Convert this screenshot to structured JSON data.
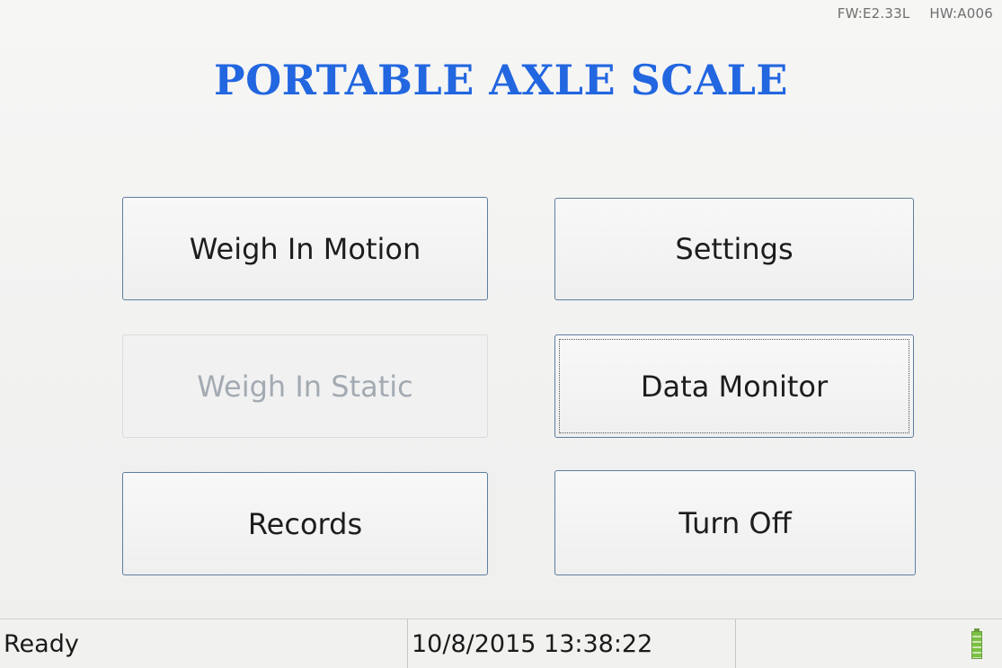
{
  "header": {
    "firmware": "FW:E2.33L",
    "hardware": "HW:A006",
    "title": "PORTABLE AXLE SCALE"
  },
  "menu": {
    "weigh_in_motion": "Weigh In Motion",
    "settings": "Settings",
    "weigh_in_static": "Weigh In Static",
    "data_monitor": "Data Monitor",
    "records": "Records",
    "turn_off": "Turn Off"
  },
  "status_bar": {
    "status": "Ready",
    "datetime": "10/8/2015 13:38:22",
    "battery_icon": "battery-full-icon"
  },
  "colors": {
    "title": "#2266e0",
    "battery": "#7ac143",
    "disabled_text": "#a3aab2"
  }
}
